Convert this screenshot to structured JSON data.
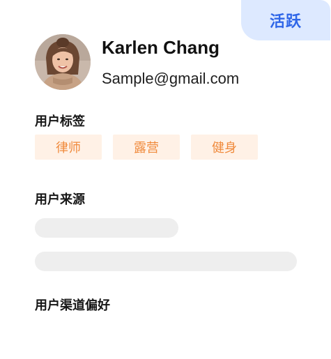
{
  "status": {
    "label": "活跃"
  },
  "user": {
    "name": "Karlen Chang",
    "email": "Sample@gmail.com"
  },
  "sections": {
    "tags_title": "用户标签",
    "source_title": "用户来源",
    "channel_title": "用户渠道偏好"
  },
  "tags": [
    "律师",
    "露营",
    "健身"
  ],
  "colors": {
    "status_bg": "#dde9ff",
    "status_text": "#2f66e8",
    "tag_bg": "#fff1e6",
    "tag_text": "#f08a3c",
    "skeleton": "#eeeeee"
  },
  "icons": {
    "avatar": "user-photo"
  }
}
